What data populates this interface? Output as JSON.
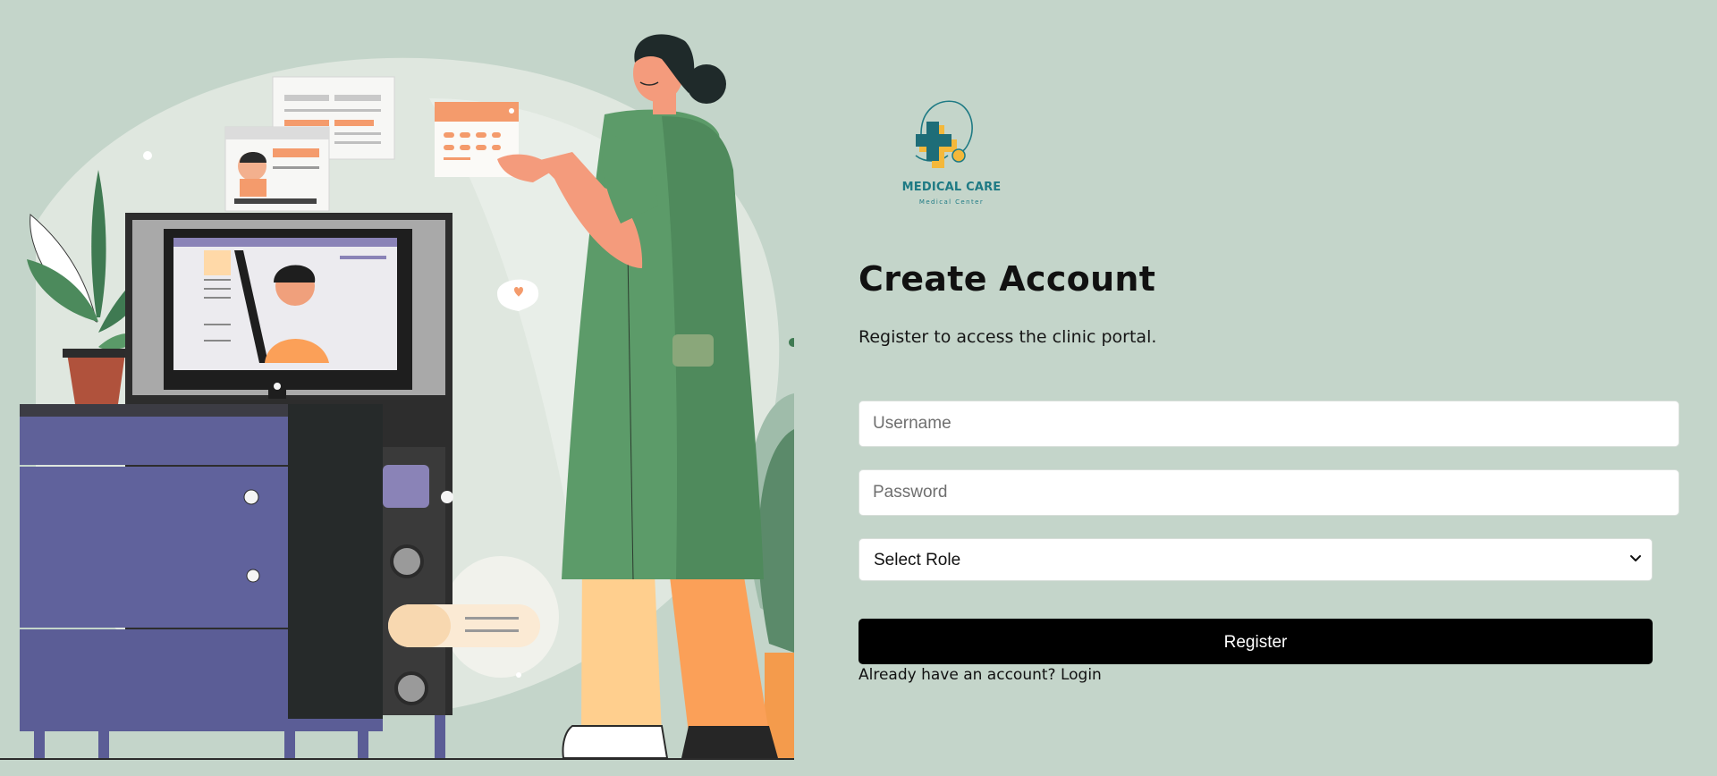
{
  "brand": {
    "name": "MEDICAL CARE",
    "tagline": "Medical Center"
  },
  "form": {
    "title": "Create Account",
    "subtitle": "Register to access the clinic portal.",
    "username_placeholder": "Username",
    "password_placeholder": "Password",
    "role_select_value": "Select Role",
    "register_label": "Register",
    "login_prompt": "Already have an account?",
    "login_link": "Login"
  },
  "colors": {
    "background": "#c4d5ca",
    "brand_teal": "#1e7a84",
    "button": "#000000"
  },
  "icons": {
    "logo": "medical-cross-stethoscope-logo",
    "select_arrow": "chevron-down-icon"
  }
}
